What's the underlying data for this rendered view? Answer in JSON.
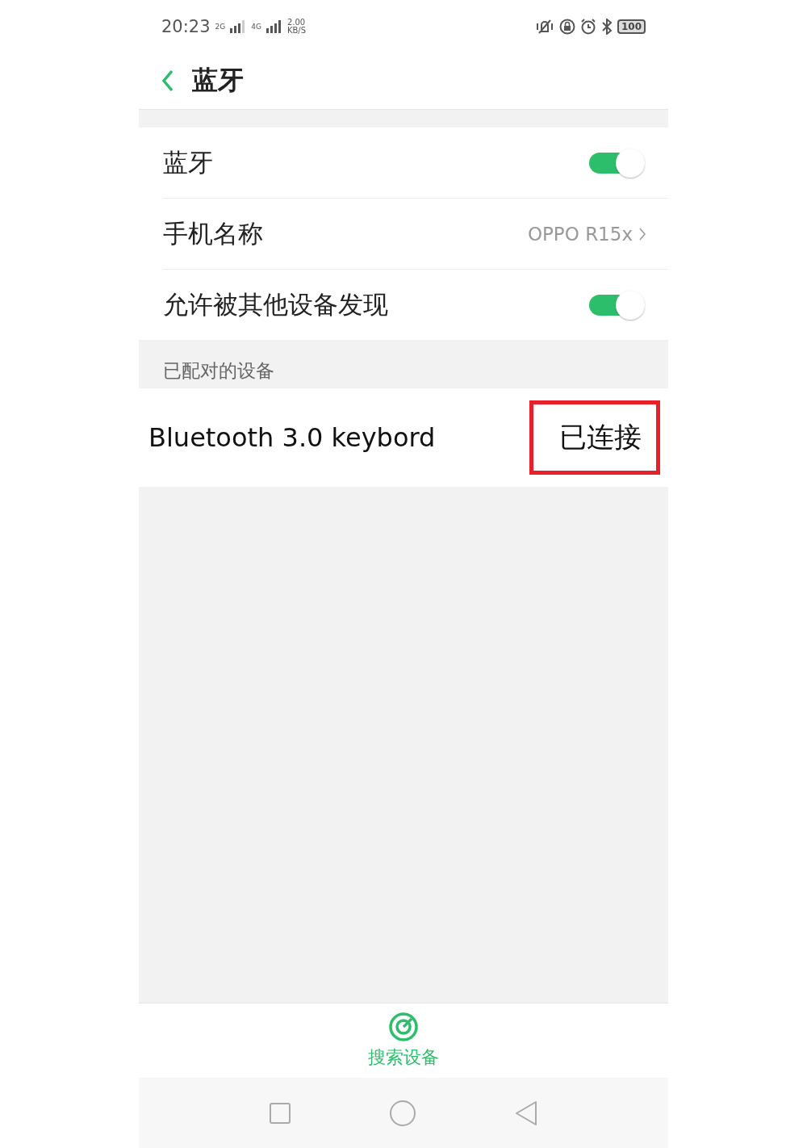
{
  "status_bar": {
    "time": "20:23",
    "sim1": "2G",
    "sim2": "4G",
    "speed_value": "2.00",
    "speed_unit": "KB/S",
    "battery": "100"
  },
  "header": {
    "title": "蓝牙"
  },
  "settings": [
    {
      "kind": "toggle",
      "label": "蓝牙",
      "on": true
    },
    {
      "kind": "link",
      "label": "手机名称",
      "value": "OPPO R15x"
    },
    {
      "kind": "toggle",
      "label": "允许被其他设备发现",
      "on": true
    }
  ],
  "paired_section": {
    "title": "已配对的设备",
    "devices": [
      {
        "name": "Bluetooth 3.0 keybord",
        "status": "已连接",
        "highlighted": true
      }
    ]
  },
  "search_button": {
    "label": "搜索设备"
  }
}
